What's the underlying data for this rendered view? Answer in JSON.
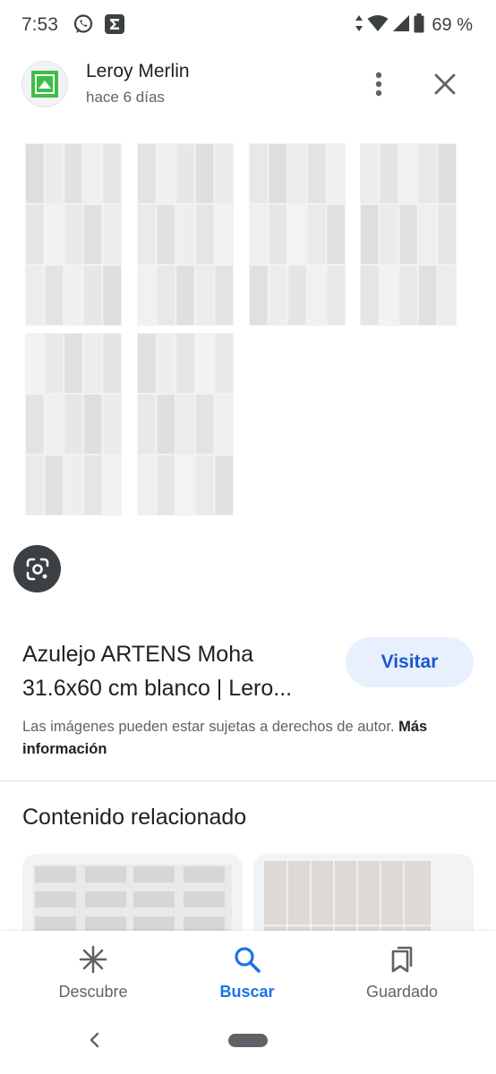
{
  "status_bar": {
    "time": "7:53",
    "battery": "69 %",
    "icons": [
      "whatsapp-icon",
      "sigma-app-icon",
      "data-arrows-icon",
      "wifi-icon",
      "signal-icon",
      "battery-icon"
    ]
  },
  "header": {
    "site_name": "Leroy Merlin",
    "posted": "hace 6 días",
    "site_icon": "leroy-merlin-logo",
    "site_icon_color": "#3ebe47",
    "more_icon": "more-vert-icon",
    "close_icon": "close-icon"
  },
  "images": {
    "count": 6,
    "tile_color": "#e4e4e4",
    "lens_icon": "google-lens-icon"
  },
  "result": {
    "title_line1": "Azulejo ARTENS Moha",
    "title_line2": "31.6x60 cm blanco | Lero...",
    "visit_label": "Visitar",
    "copyright_text": "Las imágenes pueden estar sujetas a derechos de autor.",
    "more_info_label": "Más información"
  },
  "related": {
    "heading": "Contenido relacionado"
  },
  "bottom_nav": {
    "items": [
      {
        "label": "Descubre",
        "icon": "asterisk-icon",
        "active": false
      },
      {
        "label": "Buscar",
        "icon": "search-icon",
        "active": true
      },
      {
        "label": "Guardado",
        "icon": "bookmarks-icon",
        "active": false
      }
    ],
    "active_color": "#1a73e8",
    "back_icon": "back-chevron-icon"
  }
}
